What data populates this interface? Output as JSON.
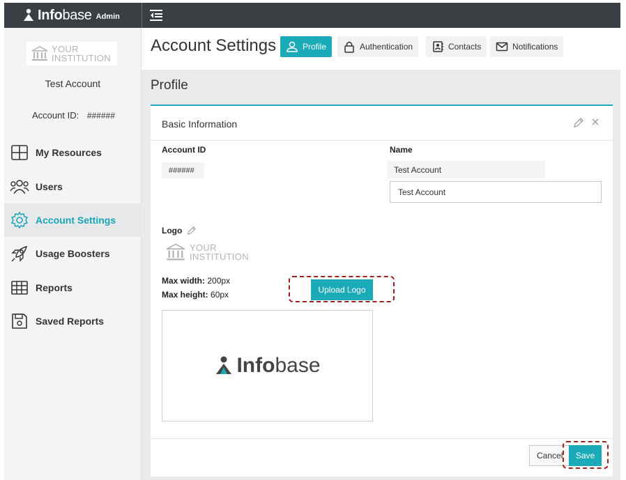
{
  "brand": {
    "part1": "Info",
    "part2": "base",
    "suffix": "Admin"
  },
  "sidebar": {
    "institution_logo_text": [
      "YOUR",
      "INSTITUTION"
    ],
    "account_name": "Test Account",
    "account_id_label": "Account ID:",
    "account_id_value": "######",
    "items": [
      {
        "label": "My Resources",
        "icon": "grid-icon",
        "active": false
      },
      {
        "label": "Users",
        "icon": "users-icon",
        "active": false
      },
      {
        "label": "Account Settings",
        "icon": "gear-icon",
        "active": true
      },
      {
        "label": "Usage Boosters",
        "icon": "rocket-icon",
        "active": false
      },
      {
        "label": "Reports",
        "icon": "table-icon",
        "active": false
      },
      {
        "label": "Saved Reports",
        "icon": "floppy-disk-icon",
        "active": false
      }
    ]
  },
  "header": {
    "title": "Account Settings",
    "tabs": [
      {
        "label": "Profile",
        "icon": "user-icon",
        "active": true
      },
      {
        "label": "Authentication",
        "icon": "lock-icon",
        "active": false
      },
      {
        "label": "Contacts",
        "icon": "contact-book-icon",
        "active": false
      },
      {
        "label": "Notifications",
        "icon": "envelope-icon",
        "active": false
      }
    ]
  },
  "profile": {
    "section_title": "Profile",
    "card_title": "Basic Information",
    "account_id_label": "Account ID",
    "account_id_value": "######",
    "name_label": "Name",
    "name_value": "Test Account",
    "name_input_value": "Test Account",
    "logo_label": "Logo",
    "logo_preview_text": [
      "YOUR",
      "INSTITUTION"
    ],
    "max_width_label": "Max width:",
    "max_width_value": "200px",
    "max_height_label": "Max height:",
    "max_height_value": "60px",
    "upload_button": "Upload Logo",
    "preview_brand": {
      "part1": "Info",
      "part2": "base"
    },
    "cancel_button": "Cancel",
    "save_button": "Save"
  },
  "colors": {
    "accent": "#1aaab8",
    "topbar": "#3a3f44",
    "highlight_dash": "#a02020"
  }
}
